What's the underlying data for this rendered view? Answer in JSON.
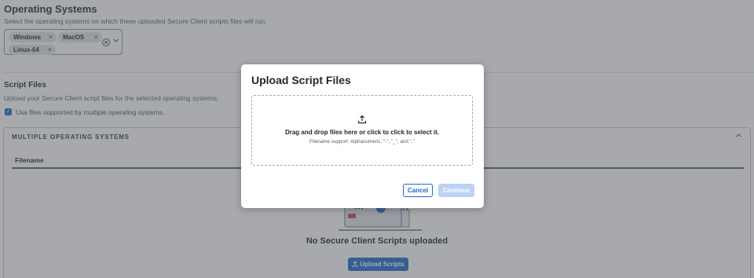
{
  "operating_systems": {
    "title": "Operating Systems",
    "description": "Select the operating systems on which these uploaded Secure Client scripts files will run.",
    "chips": [
      {
        "label": "Windows",
        "remove": "×"
      },
      {
        "label": "MacOS",
        "remove": "×"
      },
      {
        "label": "Linux-64",
        "remove": "×"
      }
    ],
    "clear_icon": "⊗",
    "chevron_icon": "⌄"
  },
  "script_files": {
    "title": "Script Files",
    "description": "Upload your Secure Client script files for the selected operating systems.",
    "checkbox_checked": true,
    "checkbox_mark": "✓",
    "checkbox_label": "Use files supported by multiple operating systems."
  },
  "multiple_os": {
    "heading": "MULTIPLE OPERATING SYSTEMS",
    "collapse_icon": "⌃",
    "column_filename": "Filename",
    "empty_message": "No Secure Client Scripts uploaded",
    "upload_button": "Upload Scripts",
    "upload_icon": "⇪"
  },
  "modal": {
    "title": "Upload Script Files",
    "drop_main": "Drag and drop files here or click to click to select it.",
    "drop_sub": "Filename support: Alphanumeric, \"-\", \"_\", and \".\"",
    "cancel": "Cancel",
    "continue": "Continue"
  },
  "colors": {
    "accent": "#1d69cc",
    "disabled_button": "#bcd2f2",
    "backdrop": "rgba(80,84,90,0.5)"
  }
}
